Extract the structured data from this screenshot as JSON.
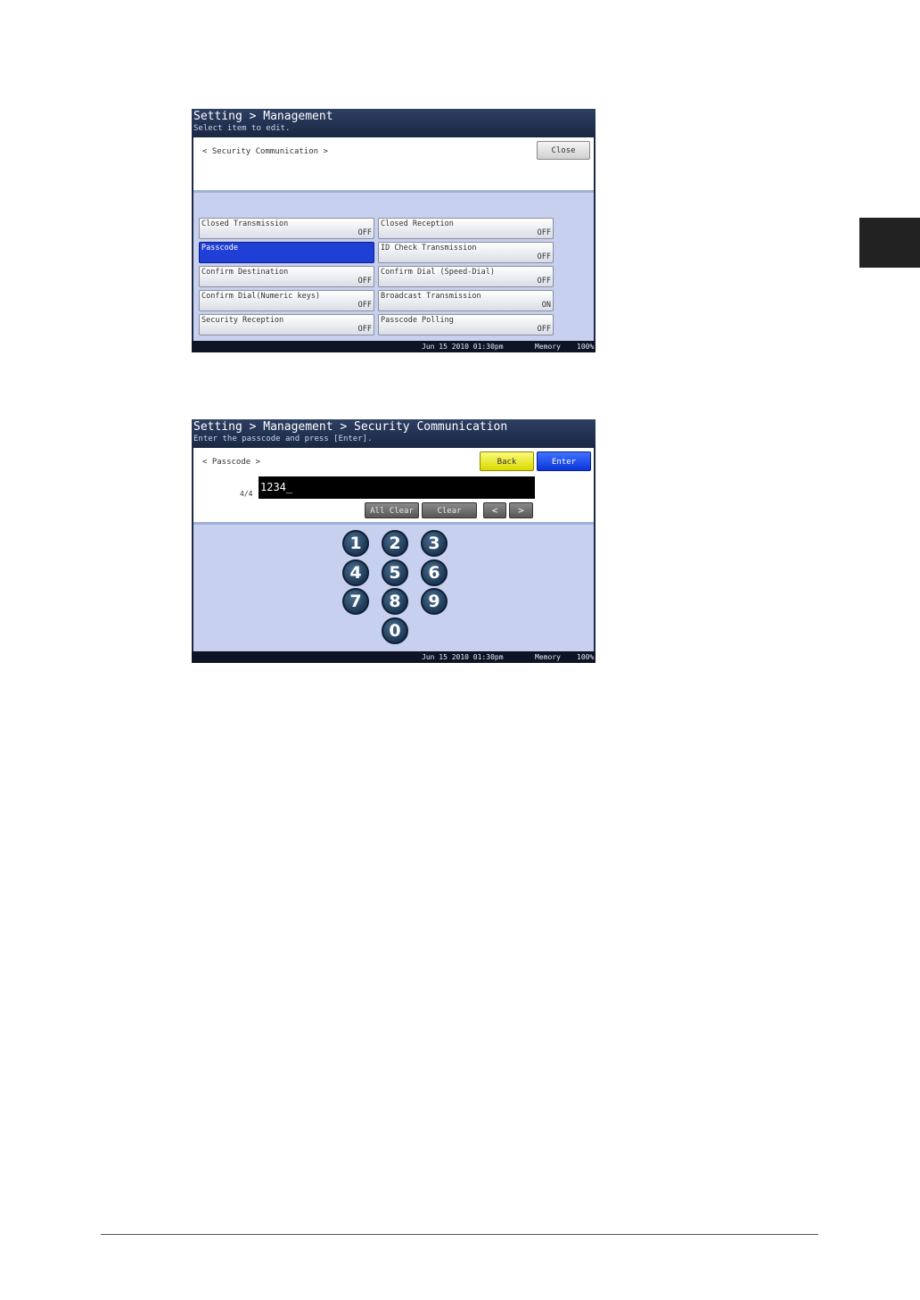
{
  "screen1": {
    "title": "Setting > Management",
    "subtitle": "Select item to edit.",
    "breadcrumb": "< Security Communication >",
    "close_label": "Close",
    "options": [
      {
        "label": "Closed Transmission",
        "value": "OFF",
        "selected": false
      },
      {
        "label": "Closed Reception",
        "value": "OFF",
        "selected": false
      },
      {
        "label": "Passcode",
        "value": "",
        "selected": true
      },
      {
        "label": "ID Check Transmission",
        "value": "OFF",
        "selected": false
      },
      {
        "label": "Confirm Destination",
        "value": "OFF",
        "selected": false
      },
      {
        "label": "Confirm Dial (Speed-Dial)",
        "value": "OFF",
        "selected": false
      },
      {
        "label": "Confirm Dial(Numeric keys)",
        "value": "OFF",
        "selected": false
      },
      {
        "label": "Broadcast Transmission",
        "value": "ON",
        "selected": false
      },
      {
        "label": "Security Reception",
        "value": "OFF",
        "selected": false
      },
      {
        "label": "Passcode Polling",
        "value": "OFF",
        "selected": false
      }
    ],
    "footer": {
      "datetime": "Jun 15 2010 01:30pm",
      "memory_label": "Memory",
      "memory_value": "100%"
    }
  },
  "screen2": {
    "title": "Setting > Management > Security Communication",
    "subtitle": "Enter the passcode and press [Enter].",
    "breadcrumb": "< Passcode >",
    "back_label": "Back",
    "enter_label": "Enter",
    "counter": "4/4",
    "entry_value": "1234_",
    "all_clear_label": "All Clear",
    "clear_label": "Clear",
    "left_arrow": "<",
    "right_arrow": ">",
    "keypad": [
      "1",
      "2",
      "3",
      "4",
      "5",
      "6",
      "7",
      "8",
      "9",
      "0"
    ],
    "footer": {
      "datetime": "Jun 15 2010 01:30pm",
      "memory_label": "Memory",
      "memory_value": "100%"
    }
  }
}
